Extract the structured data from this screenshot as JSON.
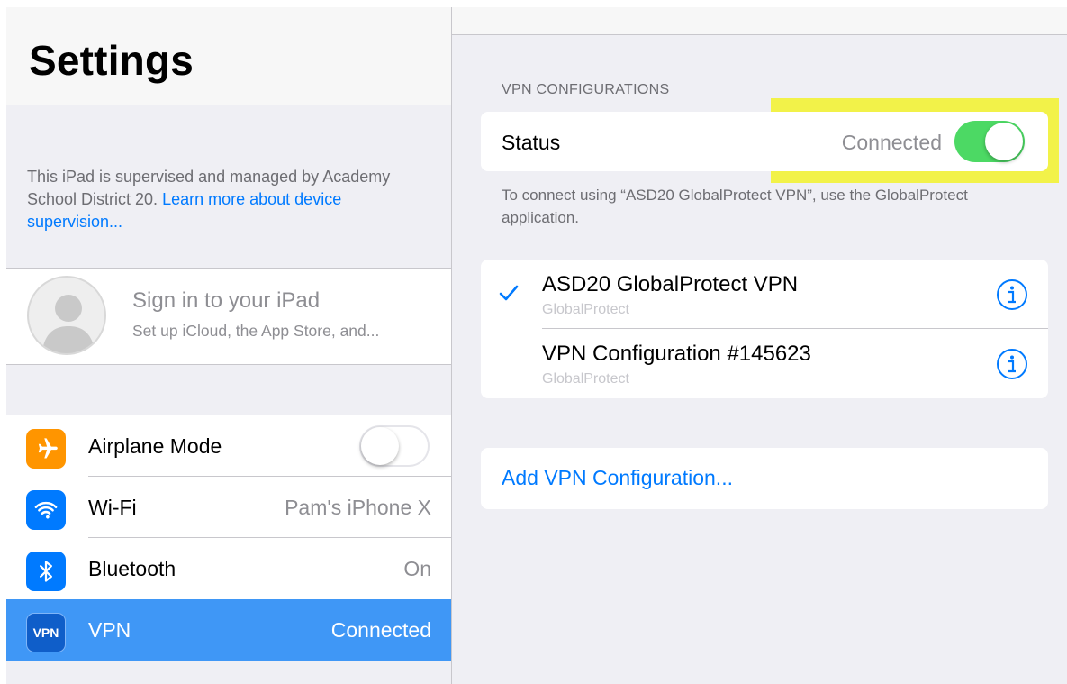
{
  "left_pane": {
    "title": "Settings",
    "supervision_text": "This iPad is supervised and managed by Academy School District 20.",
    "supervision_link": "Learn more about device supervision...",
    "account": {
      "title": "Sign in to your iPad",
      "subtitle": "Set up iCloud, the App Store, and..."
    },
    "rows": [
      {
        "label": "Airplane Mode",
        "icon": "airplane-icon",
        "icon_color": "#ff9500",
        "toggle": "off"
      },
      {
        "label": "Wi-Fi",
        "value": "Pam's iPhone X",
        "icon": "wifi-icon",
        "icon_color": "#007aff"
      },
      {
        "label": "Bluetooth",
        "value": "On",
        "icon": "bluetooth-icon",
        "icon_color": "#007aff"
      },
      {
        "label": "VPN",
        "value": "Connected",
        "icon": "vpn-icon",
        "icon_text": "VPN",
        "icon_color": "#0f5ec9",
        "selected": true
      }
    ]
  },
  "right_pane": {
    "section_header": "VPN CONFIGURATIONS",
    "status_label": "Status",
    "status_value": "Connected",
    "status_toggle": "on",
    "footer_note": "To connect using “ASD20 GlobalProtect VPN”, use the GlobalProtect application.",
    "configurations": [
      {
        "name": "ASD20 GlobalProtect VPN",
        "type": "GlobalProtect",
        "checked": true
      },
      {
        "name": "VPN Configuration #145623",
        "type": "GlobalProtect",
        "checked": false
      }
    ],
    "add_label": "Add VPN Configuration..."
  },
  "colors": {
    "accent": "#007aff",
    "selected_row": "#3f97f6",
    "toggle_on": "#4cd964",
    "highlight": "#f2f22a"
  }
}
